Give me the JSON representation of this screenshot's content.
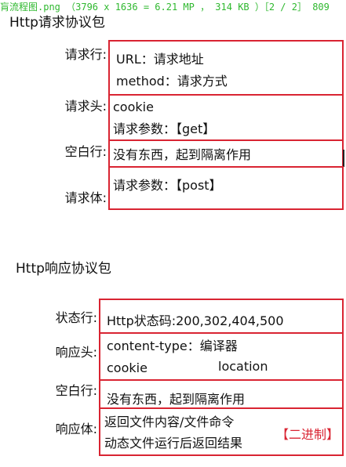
{
  "header": {
    "caption": "肓流程图.png （3796 x 1636 = 6.21 MP ， 314 KB ）［2 / 2］ 809"
  },
  "request": {
    "title": "Http请求协议包",
    "rows": [
      {
        "label": "请求行:",
        "lines": [
          "URL：请求地址",
          "method：请求方式"
        ]
      },
      {
        "label": "请求头:",
        "lines": [
          "cookie",
          "请求参数：【get】"
        ]
      },
      {
        "label": "空白行:",
        "lines": [
          "没有东西，起到隔离作用"
        ]
      },
      {
        "label": "请求体:",
        "lines": [
          "请求参数：【post】"
        ]
      }
    ]
  },
  "response": {
    "title": "Http响应协议包",
    "rows": [
      {
        "label": "状态行:",
        "lines": [
          "Http状态码:200,302,404,500"
        ]
      },
      {
        "label": "响应头:",
        "lines": [
          "content-type：编译器",
          "cookie",
          "location"
        ]
      },
      {
        "label": "空白行:",
        "lines": [
          "没有东西，起到隔离作用"
        ]
      },
      {
        "label": "响应体:",
        "lines": [
          "返回文件内容/文件命令",
          "动态文件运行后返回结果"
        ],
        "tag": "【二进制】"
      }
    ]
  }
}
